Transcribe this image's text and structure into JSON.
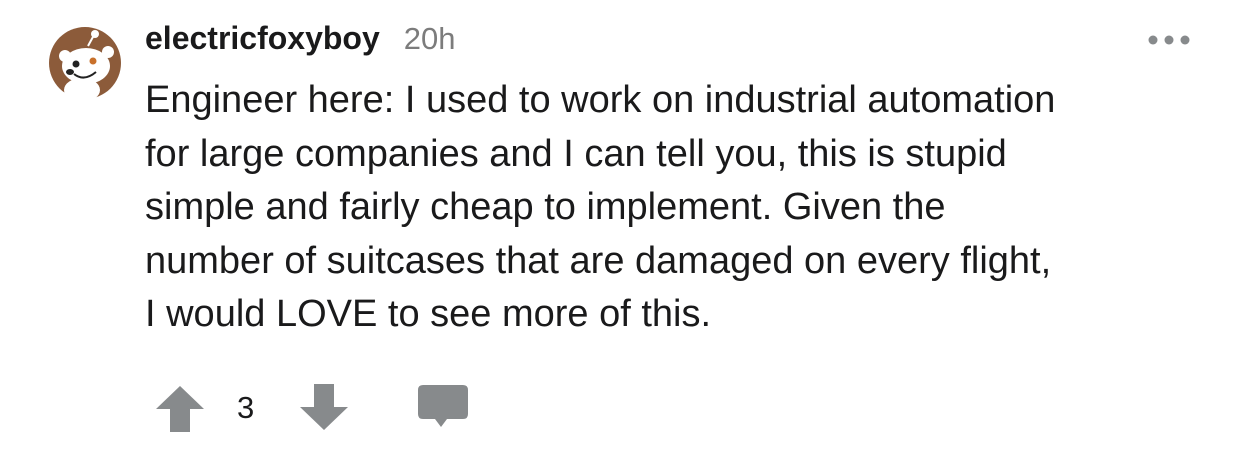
{
  "comment": {
    "username": "electricfoxyboy",
    "timestamp": "20h",
    "body": "Engineer here: I used to work on industrial automation\nfor large companies and I can tell you, this is stupid\nsimple and fairly cheap to implement. Given the\nnumber of suitcases that are damaged on every flight,\nI would LOVE to see more of this.",
    "score": "3"
  },
  "icons": {
    "avatar": "snoo-avatar-icon",
    "more": "more-options-icon",
    "upvote": "upvote-arrow-icon",
    "downvote": "downvote-arrow-icon",
    "reply": "comment-bubble-icon"
  },
  "colors": {
    "text": "#1a1a1b",
    "meta": "#7c7c7c",
    "icon_gray": "#878a8c",
    "avatar_brown": "#8c5b3a"
  }
}
